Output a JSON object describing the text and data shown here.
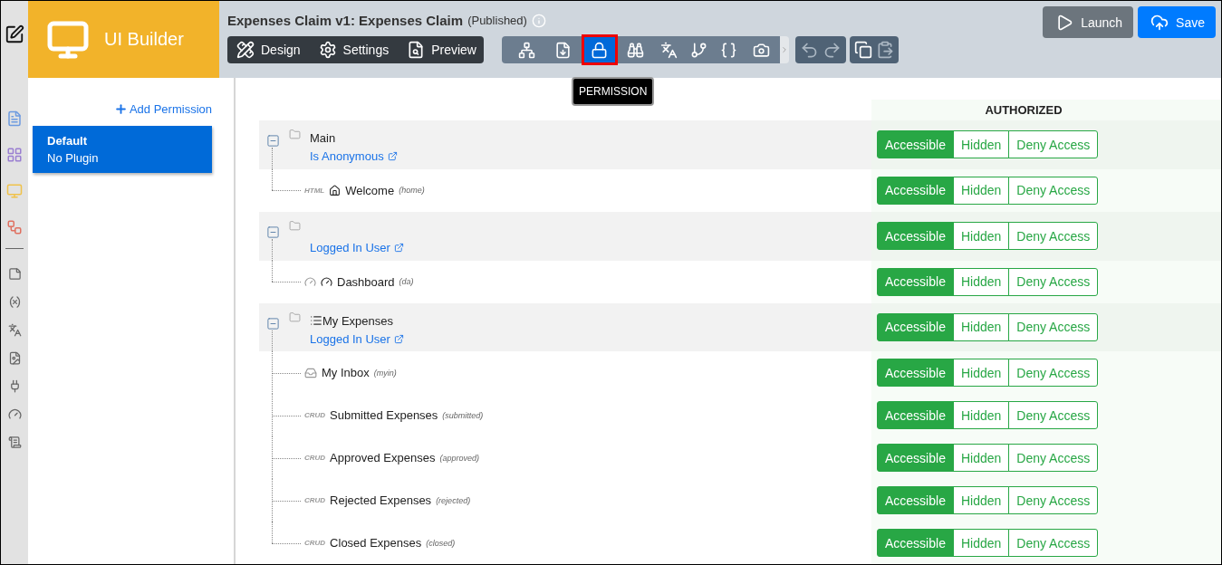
{
  "brand": {
    "title": "UI Builder"
  },
  "header": {
    "title": "Expenses Claim v1: Expenses Claim",
    "status": "(Published)"
  },
  "mode_tabs": [
    {
      "kind": "design",
      "label": "Design"
    },
    {
      "kind": "settings",
      "label": "Settings"
    },
    {
      "kind": "preview",
      "label": "Preview"
    }
  ],
  "tools": [
    {
      "kind": "sitemap",
      "selected": false
    },
    {
      "kind": "page",
      "selected": false
    },
    {
      "kind": "lock",
      "selected": true
    },
    {
      "kind": "binoculars",
      "selected": false
    },
    {
      "kind": "translate",
      "selected": false
    },
    {
      "kind": "branch",
      "selected": false
    },
    {
      "kind": "braces",
      "selected": false
    },
    {
      "kind": "camera",
      "selected": false
    }
  ],
  "tooltip": "PERMISSION",
  "actions": [
    {
      "kind": "launch",
      "label": "Launch"
    },
    {
      "kind": "save",
      "label": "Save"
    }
  ],
  "sidebar": {
    "add_label": "Add Permission",
    "items": [
      {
        "title": "Default",
        "subtitle": "No Plugin",
        "selected": true
      }
    ]
  },
  "column_header": "AUTHORIZED",
  "groups": [
    {
      "kind": "folder",
      "name": "Main",
      "rule": "Is Anonymous",
      "expanded": true,
      "access": [
        {
          "label": "Accessible",
          "selected": true
        },
        {
          "label": "Hidden",
          "selected": false
        },
        {
          "label": "Deny Access",
          "selected": false
        }
      ],
      "children": [
        {
          "kind": "html",
          "tag": "HTML",
          "name": "Welcome",
          "code": "(home)",
          "access": [
            {
              "label": "Accessible",
              "selected": true
            },
            {
              "label": "Hidden",
              "selected": false
            },
            {
              "label": "Deny Access",
              "selected": false
            }
          ]
        }
      ]
    },
    {
      "kind": "folder",
      "rule": "Logged In User",
      "expanded": true,
      "access": [
        {
          "label": "Accessible",
          "selected": true
        },
        {
          "label": "Hidden",
          "selected": false
        },
        {
          "label": "Deny Access",
          "selected": false
        }
      ],
      "children": [
        {
          "kind": "dashboard",
          "name": "Dashboard",
          "code": "(da)",
          "access": [
            {
              "label": "Accessible",
              "selected": true
            },
            {
              "label": "Hidden",
              "selected": false
            },
            {
              "label": "Deny Access",
              "selected": false
            }
          ]
        }
      ]
    },
    {
      "kind": "list",
      "name": "My Expenses",
      "rule": "Logged In User",
      "expanded": true,
      "access": [
        {
          "label": "Accessible",
          "selected": true
        },
        {
          "label": "Hidden",
          "selected": false
        },
        {
          "label": "Deny Access",
          "selected": false
        }
      ],
      "children": [
        {
          "kind": "inbox",
          "name": "My Inbox",
          "code": "(myin)",
          "access": [
            {
              "label": "Accessible",
              "selected": true
            },
            {
              "label": "Hidden",
              "selected": false
            },
            {
              "label": "Deny Access",
              "selected": false
            }
          ]
        },
        {
          "kind": "crud",
          "tag": "CRUD",
          "name": "Submitted Expenses",
          "code": "(submitted)",
          "access": [
            {
              "label": "Accessible",
              "selected": true
            },
            {
              "label": "Hidden",
              "selected": false
            },
            {
              "label": "Deny Access",
              "selected": false
            }
          ]
        },
        {
          "kind": "crud",
          "tag": "CRUD",
          "name": "Approved Expenses",
          "code": "(approved)",
          "access": [
            {
              "label": "Accessible",
              "selected": true
            },
            {
              "label": "Hidden",
              "selected": false
            },
            {
              "label": "Deny Access",
              "selected": false
            }
          ]
        },
        {
          "kind": "crud",
          "tag": "CRUD",
          "name": "Rejected Expenses",
          "code": "(rejected)",
          "access": [
            {
              "label": "Accessible",
              "selected": true
            },
            {
              "label": "Hidden",
              "selected": false
            },
            {
              "label": "Deny Access",
              "selected": false
            }
          ]
        },
        {
          "kind": "crud",
          "tag": "CRUD",
          "name": "Closed Expenses",
          "code": "(closed)",
          "access": [
            {
              "label": "Accessible",
              "selected": true
            },
            {
              "label": "Hidden",
              "selected": false
            },
            {
              "label": "Deny Access",
              "selected": false
            }
          ]
        }
      ]
    }
  ]
}
